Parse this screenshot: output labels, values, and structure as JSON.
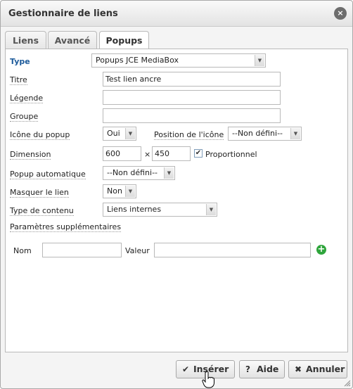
{
  "window": {
    "title": "Gestionnaire de liens",
    "close_label": "×"
  },
  "tabs": [
    {
      "label": "Liens"
    },
    {
      "label": "Avancé"
    },
    {
      "label": "Popups"
    }
  ],
  "form": {
    "type": {
      "label": "Type",
      "value": "Popups JCE MediaBox"
    },
    "titre": {
      "label": "Titre",
      "value": "Test lien ancre"
    },
    "legende": {
      "label": "Légende",
      "value": ""
    },
    "groupe": {
      "label": "Groupe",
      "value": ""
    },
    "icone": {
      "label": "Icône du popup",
      "value": "Oui"
    },
    "position_icone": {
      "label": "Position de l'icône",
      "value": "--Non défini--"
    },
    "dimension": {
      "label": "Dimension",
      "width": "600",
      "separator": "×",
      "height": "450",
      "proportionnel": "Proportionnel",
      "proportionnel_checked": true
    },
    "popup_auto": {
      "label": "Popup automatique",
      "value": "--Non défini--"
    },
    "masquer": {
      "label": "Masquer le lien",
      "value": "Non"
    },
    "type_contenu": {
      "label": "Type de contenu",
      "value": "Liens internes"
    },
    "parametres": {
      "label": "Paramètres supplémentaires",
      "nom_label": "Nom",
      "nom_value": "",
      "valeur_label": "Valeur",
      "valeur_value": ""
    }
  },
  "footer": {
    "inserer": "Insérer",
    "aide": "Aide",
    "annuler": "Annuler"
  },
  "icons": {
    "check": "✔",
    "help": "?",
    "cancel": "✖",
    "add": "+",
    "dropdown": "▼"
  }
}
